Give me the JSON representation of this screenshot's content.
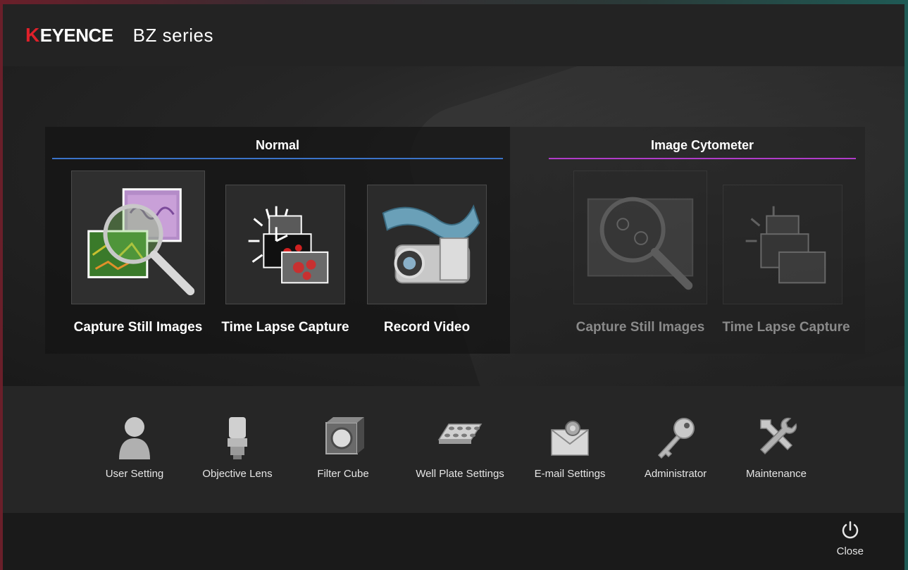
{
  "header": {
    "brand": "KEYENCE",
    "brand_mark": "K",
    "brand_rest": "EYENCE",
    "product": "BZ series"
  },
  "sections": {
    "normal": {
      "title": "Normal",
      "accent": "#3b73c9"
    },
    "cytometer": {
      "title": "Image Cytometer",
      "accent": "#b03cc9"
    }
  },
  "normal_tiles": [
    {
      "label": "Capture Still Images",
      "icon": "magnifier-micrograph-icon"
    },
    {
      "label": "Time Lapse Capture",
      "icon": "clock-images-icon"
    },
    {
      "label": "Record Video",
      "icon": "video-camera-film-icon"
    }
  ],
  "cyto_tiles": [
    {
      "label": "Capture Still Images",
      "icon": "magnifier-cells-icon"
    },
    {
      "label": "Time Lapse Capture",
      "icon": "clock-cells-icon"
    }
  ],
  "settings": [
    {
      "label": "User Setting",
      "icon": "user-icon"
    },
    {
      "label": "Objective Lens",
      "icon": "objective-lens-icon"
    },
    {
      "label": "Filter Cube",
      "icon": "filter-cube-icon"
    },
    {
      "label": "Well Plate Settings",
      "icon": "well-plate-icon"
    },
    {
      "label": "E-mail Settings",
      "icon": "email-gear-icon"
    },
    {
      "label": "Administrator",
      "icon": "key-icon"
    },
    {
      "label": "Maintenance",
      "icon": "tools-icon"
    }
  ],
  "footer": {
    "close_label": "Close",
    "close_icon": "power-icon"
  },
  "colors": {
    "brand_red": "#e0202a",
    "background": "#1e1e1e"
  }
}
